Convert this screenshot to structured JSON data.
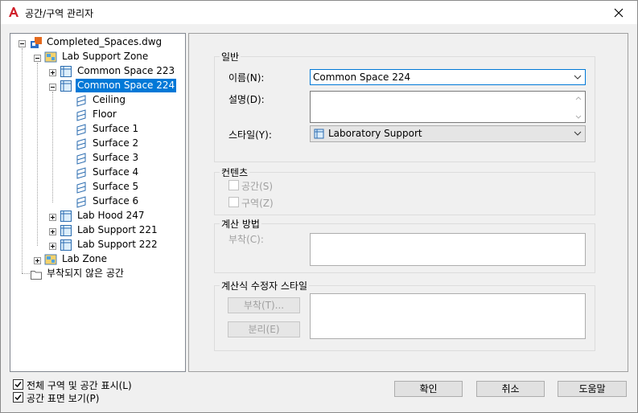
{
  "window": {
    "title": "공간/구역 관리자",
    "app_icon": "autocad-a-icon",
    "close_icon": "close-x-icon"
  },
  "tree": {
    "root": "Completed_Spaces.dwg",
    "lab_support_zone": "Lab Support Zone",
    "common_space_223": "Common Space 223",
    "common_space_224": "Common Space 224",
    "surfaces": [
      "Ceiling",
      "Floor",
      "Surface 1",
      "Surface 2",
      "Surface 3",
      "Surface 4",
      "Surface 5",
      "Surface 6"
    ],
    "lab_hood_247": "Lab Hood 247",
    "lab_support_221": "Lab Support 221",
    "lab_support_222": "Lab Support 222",
    "lab_zone": "Lab Zone",
    "unattached": "부착되지 않은 공간"
  },
  "general": {
    "title": "일반",
    "name_label": "이름(N):",
    "name_value": "Common Space 224",
    "desc_label": "설명(D):",
    "desc_value": "",
    "style_label": "스타일(Y):",
    "style_value": "Laboratory Support"
  },
  "contents": {
    "title": "컨텐츠",
    "space_label": "공간(S)",
    "zone_label": "구역(Z)"
  },
  "calc": {
    "title": "계산 방법",
    "attach_label": "부착(C):"
  },
  "modifier": {
    "title": "계산식 수정자 스타일",
    "attach_button": "부착(T)...",
    "detach_button": "분리(E)"
  },
  "footer": {
    "show_all_label": "전체 구역 및 공간 표시(L)",
    "show_surfaces_label": "공간 표면 보기(P)",
    "ok": "확인",
    "cancel": "취소",
    "help": "도움말"
  },
  "colors": {
    "selection": "#0078d7",
    "panel_bg": "#f0f0f0"
  }
}
